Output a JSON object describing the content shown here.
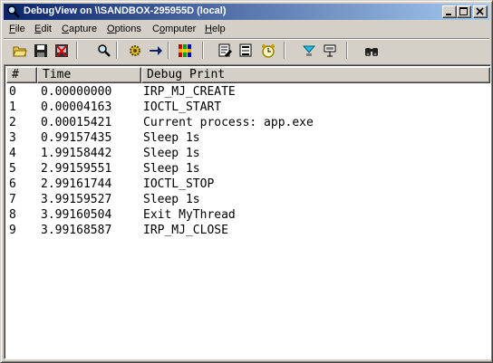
{
  "window": {
    "title": "DebugView on \\\\SANDBOX-295955D (local)",
    "title_icon": "magnifier-icon",
    "controls": [
      "minimize-icon",
      "maximize-icon",
      "close-icon"
    ]
  },
  "menu": [
    {
      "label": "File",
      "accel": "F",
      "rest": "ile"
    },
    {
      "label": "Edit",
      "accel": "E",
      "rest": "dit"
    },
    {
      "label": "Capture",
      "accel": "C",
      "rest": "apture"
    },
    {
      "label": "Options",
      "accel": "O",
      "rest": "ptions"
    },
    {
      "label": "Computer",
      "accel": "o",
      "pre": "C",
      "rest": "mputer"
    },
    {
      "label": "Help",
      "accel": "H",
      "rest": "elp"
    }
  ],
  "toolbar": {
    "buttons": [
      "open-folder-icon",
      "save-icon",
      "clear-display-icon",
      "capture-magnifier-icon",
      "autoscroll-arrow-icon",
      "capture-kernel-gear-icon",
      "capture-win32-icon",
      "highlight-icon",
      "filter-icon",
      "clock-time-icon",
      "log-boot-icon",
      "find-binoculars-icon"
    ]
  },
  "table": {
    "columns": [
      "#",
      "Time",
      "Debug Print"
    ],
    "rows": [
      {
        "num": "0",
        "time": "0.00000000",
        "msg": "IRP_MJ_CREATE"
      },
      {
        "num": "1",
        "time": "0.00004163",
        "msg": "IOCTL_START"
      },
      {
        "num": "2",
        "time": "0.00015421",
        "msg": "Current process: app.exe"
      },
      {
        "num": "3",
        "time": "0.99157435",
        "msg": "Sleep 1s"
      },
      {
        "num": "4",
        "time": "1.99158442",
        "msg": "Sleep 1s"
      },
      {
        "num": "5",
        "time": "2.99159551",
        "msg": "Sleep 1s"
      },
      {
        "num": "6",
        "time": "2.99161744",
        "msg": "IOCTL_STOP"
      },
      {
        "num": "7",
        "time": "3.99159527",
        "msg": "Sleep 1s"
      },
      {
        "num": "8",
        "time": "3.99160504",
        "msg": "Exit MyThread"
      },
      {
        "num": "9",
        "time": "3.99168587",
        "msg": "IRP_MJ_CLOSE"
      }
    ]
  },
  "colors": {
    "title_start": "#0a246a",
    "title_end": "#a6caf0",
    "face": "#d4d0c8"
  }
}
